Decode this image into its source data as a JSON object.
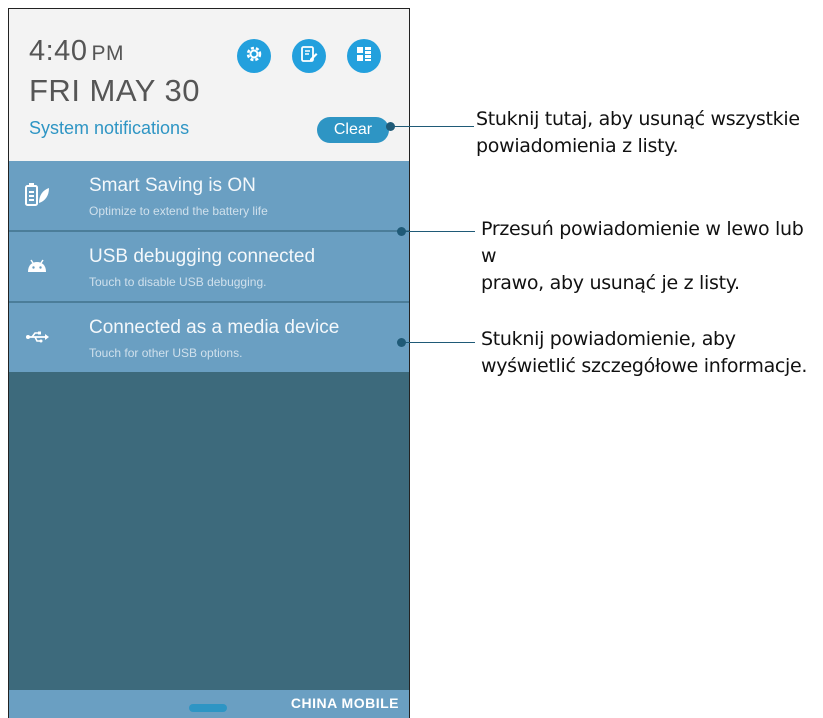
{
  "header": {
    "time": "4:40",
    "ampm": "PM",
    "date": "FRI MAY 30",
    "system_notifications": "System notifications",
    "clear_label": "Clear"
  },
  "quick_settings": [
    {
      "icon": "gear-icon"
    },
    {
      "icon": "edit-icon"
    },
    {
      "icon": "apps-grid-icon"
    }
  ],
  "notifications": [
    {
      "icon": "battery-leaf-icon",
      "title": "Smart Saving is ON",
      "subtitle": "Optimize to extend the battery life"
    },
    {
      "icon": "android-icon",
      "title": "USB debugging connected",
      "subtitle": "Touch to disable USB debugging."
    },
    {
      "icon": "usb-icon",
      "title": "Connected as a media device",
      "subtitle": "Touch for other USB options."
    }
  ],
  "bottom_bar": {
    "carrier": "CHINA  MOBILE"
  },
  "callouts": [
    {
      "line1": "Stuknij tutaj, aby usunąć wszystkie",
      "line2": "powiadomienia z listy."
    },
    {
      "line1": "Przesuń powiadomienie w lewo lub w",
      "line2": "prawo, aby usunąć je z listy."
    },
    {
      "line1": "Stuknij powiadomienie, aby",
      "line2": "wyświetlić szczegółowe informacje."
    }
  ],
  "colors": {
    "accent": "#23a0dd",
    "notification_bg": "#6a9fc2",
    "shade_bg": "#3d6a7c",
    "header_bg": "#f3f3f3"
  }
}
